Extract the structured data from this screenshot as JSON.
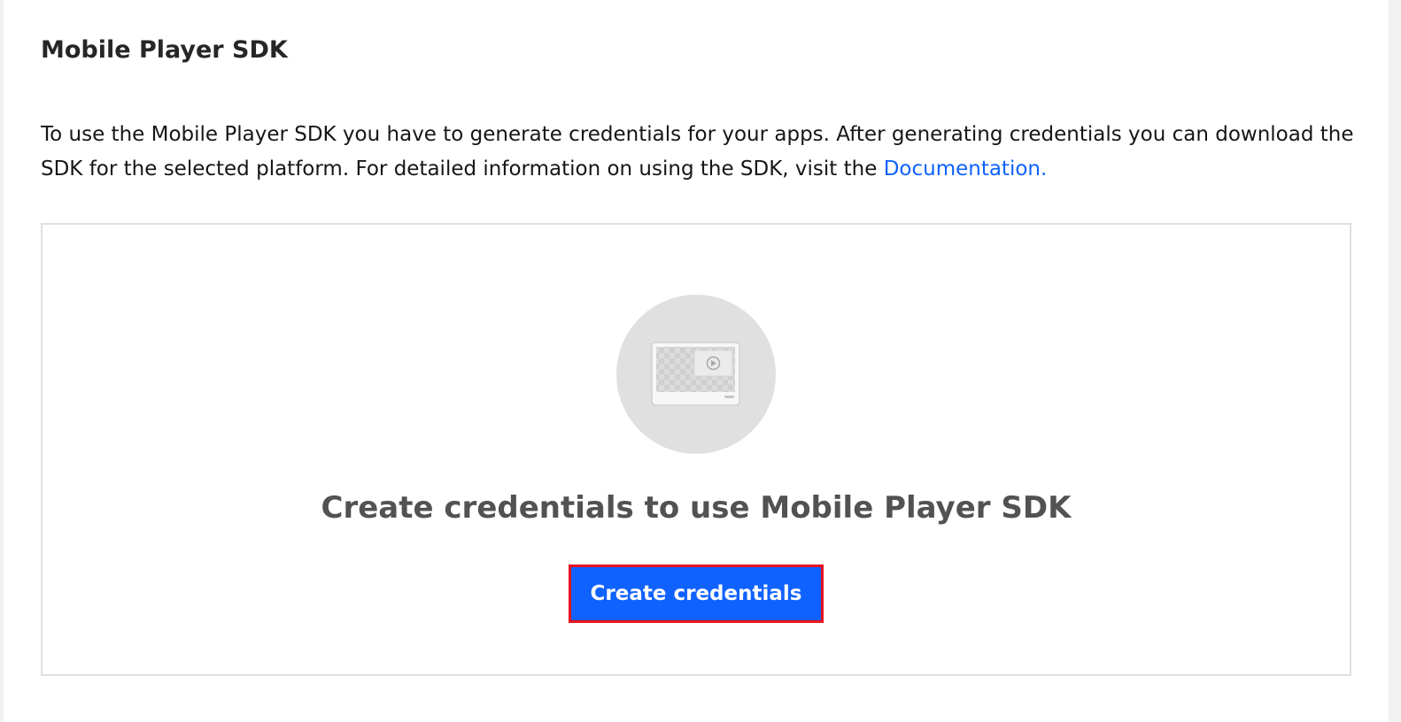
{
  "section": {
    "title": "Mobile Player SDK",
    "description": "To use the Mobile Player SDK you have to generate credentials for your apps. After generating credentials you can download the SDK for the selected platform. For detailed information on using the SDK, visit the",
    "link_label": "Documentation."
  },
  "empty_state": {
    "icon": "video-player-illustration-icon",
    "heading": "Create credentials to use Mobile Player SDK",
    "button_label": "Create credentials"
  },
  "colors": {
    "link": "#0f62fe",
    "primary_button": "#0f62fe",
    "button_highlight_border": "#e8131f",
    "panel_border": "#e0e0e0",
    "illustration_bg": "#e0e0e0"
  }
}
